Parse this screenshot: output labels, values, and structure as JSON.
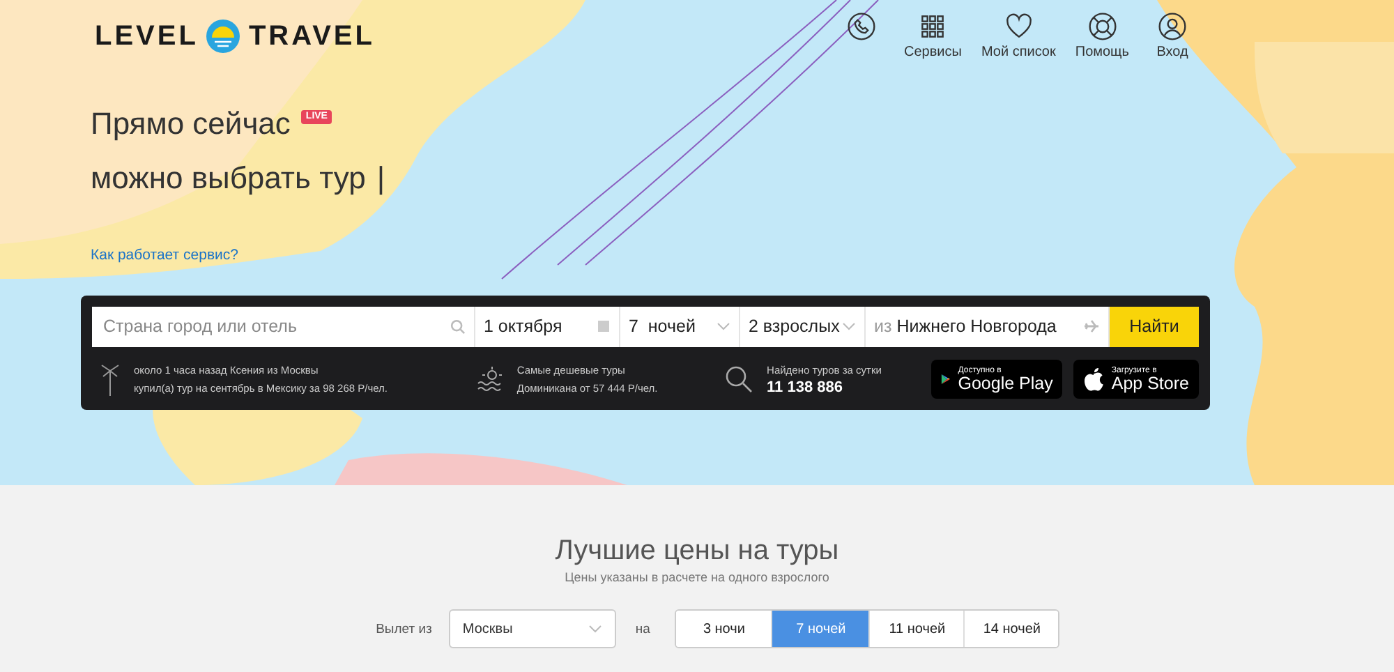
{
  "logo": {
    "left": "LEVEL",
    "right": "TRAVEL"
  },
  "nav": [
    {
      "kind": "phone"
    },
    {
      "kind": "grid",
      "label": "Сервисы"
    },
    {
      "kind": "heart",
      "label": "Мой список"
    },
    {
      "kind": "lifebuoy",
      "label": "Помощь"
    },
    {
      "kind": "user",
      "label": "Вход"
    }
  ],
  "headline": {
    "line1": "Прямо сейчас",
    "badge": "LIVE",
    "line2": "можно выбрать тур",
    "cursor": "|"
  },
  "how_link": "Как работает сервис?",
  "search": {
    "destination": {
      "placeholder": "Страна город или отель"
    },
    "date": "1 октября",
    "nights": "7  ночей",
    "people": "2 взрослых",
    "from_prefix": "из",
    "from": "Нижнего Новгорода",
    "button": "Найти"
  },
  "info": {
    "recent": [
      "около 1 часа назад Ксения из Москвы",
      "купил(а) тур на сентябрь в Мексику за 98 268 Р/чел."
    ],
    "cheapest": [
      "Самые дешевые туры",
      "Доминикана от 57 444 Р/чел."
    ],
    "found_label": "Найдено туров за сутки",
    "found_value": "11 138 886"
  },
  "stores": [
    {
      "kind": "google",
      "small": "Доступно в",
      "big": "Google Play"
    },
    {
      "kind": "apple",
      "small": "Загрузите в",
      "big": "App Store"
    }
  ],
  "prices": {
    "title": "Лучшие цены на туры",
    "subtitle": "Цены указаны в расчете на одного взрослого",
    "departure_label": "Вылет из",
    "departure": "Москвы",
    "on_label": "на",
    "tabs": [
      {
        "label": "3 ночи",
        "selected": false
      },
      {
        "label": "7 ночей",
        "selected": true
      },
      {
        "label": "11 ночей",
        "selected": false
      },
      {
        "label": "14 ночей",
        "selected": false
      }
    ]
  }
}
